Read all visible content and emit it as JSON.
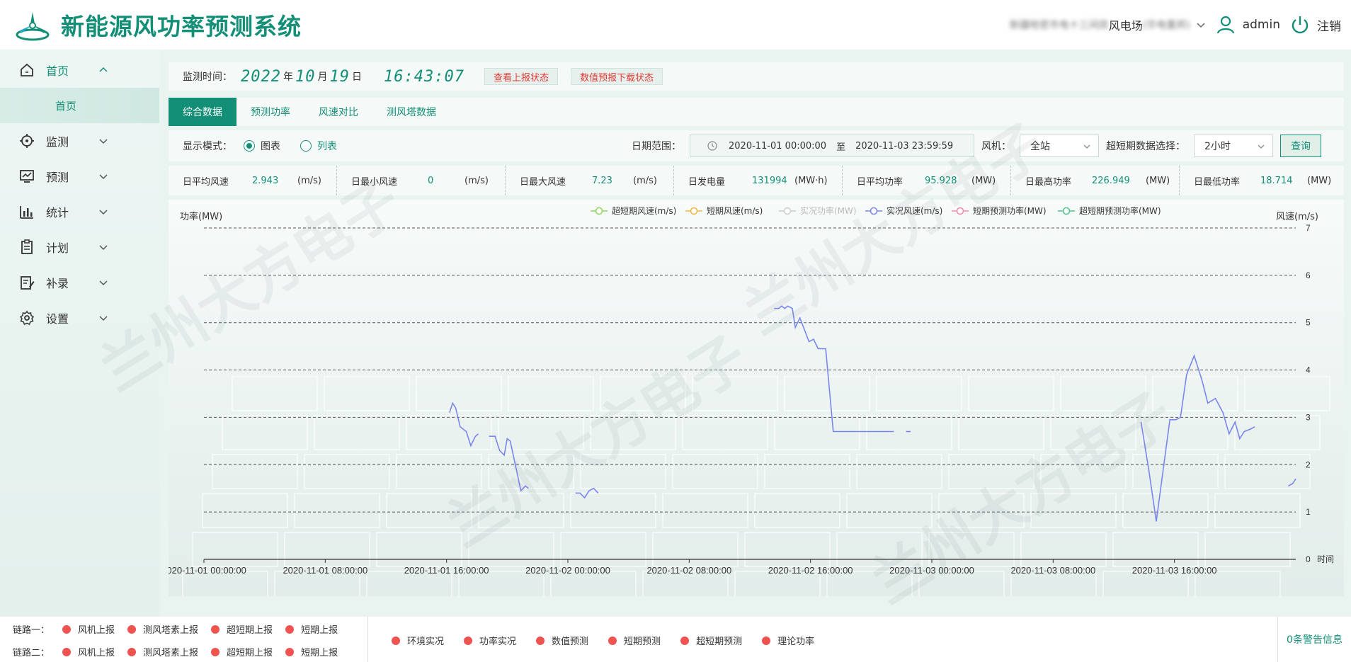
{
  "app": {
    "title": "新能源风功率预测系统"
  },
  "header": {
    "farm_prefix_blur": "新疆哈密市电十三间房",
    "farm_name": "风电场",
    "farm_suffix_blur": "(华电重邦)",
    "user": "admin",
    "logout": "注销"
  },
  "sidebar": {
    "items": [
      {
        "label": "首页",
        "icon": "home-icon"
      },
      {
        "label": "监测",
        "icon": "target-icon"
      },
      {
        "label": "预测",
        "icon": "forecast-icon"
      },
      {
        "label": "统计",
        "icon": "bar-chart-icon"
      },
      {
        "label": "计划",
        "icon": "clipboard-icon"
      },
      {
        "label": "补录",
        "icon": "edit-icon"
      },
      {
        "label": "设置",
        "icon": "gear-icon"
      }
    ],
    "sub_home": "首页"
  },
  "monitor": {
    "label": "监测时间：",
    "year": "2022",
    "year_unit": "年",
    "month": "10",
    "month_unit": "月",
    "day": "19",
    "day_unit": "日",
    "time": "16:43:07",
    "btn_report": "查看上报状态",
    "btn_download": "数值预报下载状态"
  },
  "tabs": [
    "综合数据",
    "预测功率",
    "风速对比",
    "测风塔数据"
  ],
  "filter": {
    "mode_label": "显示模式：",
    "mode_chart": "图表",
    "mode_list": "列表",
    "date_label": "日期范围：",
    "date_start": "2020-11-01 00:00:00",
    "date_sep": "至",
    "date_end": "2020-11-03 23:59:59",
    "fan_label": "风机：",
    "fan_value": "全站",
    "ss_label": "超短期数据选择：",
    "ss_value": "2小时",
    "query": "查询"
  },
  "stats": [
    {
      "label": "日平均风速",
      "value": "2.943",
      "unit": "(m/s)"
    },
    {
      "label": "日最小风速",
      "value": "0",
      "unit": "(m/s)"
    },
    {
      "label": "日最大风速",
      "value": "7.23",
      "unit": "(m/s)"
    },
    {
      "label": "日发电量",
      "value": "131994",
      "unit": "(MW·h)"
    },
    {
      "label": "日平均功率",
      "value": "95.928",
      "unit": "(MW)"
    },
    {
      "label": "日最高功率",
      "value": "226.949",
      "unit": "(MW)"
    },
    {
      "label": "日最低功率",
      "value": "18.714",
      "unit": "(MW)"
    }
  ],
  "chart_data": {
    "type": "line",
    "y_left_label": "功率(MW)",
    "y_right_label": "风速(m/s)",
    "x_axis_name": "时间",
    "y_right_range": [
      0,
      7
    ],
    "y_right_ticks": [
      "0",
      "1",
      "2",
      "3",
      "4",
      "5",
      "6",
      "7"
    ],
    "x_ticks": [
      "2020-11-01 00:00:00",
      "2020-11-01 08:00:00",
      "2020-11-01 16:00:00",
      "2020-11-02 00:00:00",
      "2020-11-02 08:00:00",
      "2020-11-02 16:00:00",
      "2020-11-03 00:00:00",
      "2020-11-03 08:00:00",
      "2020-11-03 16:00:00"
    ],
    "x_range_hours": [
      0,
      72
    ],
    "legend": [
      {
        "name": "超短期风速(m/s)",
        "color": "#8fd45a",
        "active": true
      },
      {
        "name": "短期风速(m/s)",
        "color": "#f2b63c",
        "active": true
      },
      {
        "name": "实况功率(MW)",
        "color": "#cccccc",
        "active": false
      },
      {
        "name": "实况风速(m/s)",
        "color": "#7a86ee",
        "active": true
      },
      {
        "name": "短期预测功率(MW)",
        "color": "#f58aa6",
        "active": true
      },
      {
        "name": "超短期预测功率(MW)",
        "color": "#4cc38a",
        "active": true
      }
    ],
    "series": [
      {
        "name": "实况风速(m/s)",
        "color": "#7a86ee",
        "segments": [
          [
            [
              16.2,
              3.1
            ],
            [
              16.4,
              3.3
            ],
            [
              16.6,
              3.2
            ],
            [
              16.9,
              2.8
            ],
            [
              17.3,
              2.7
            ],
            [
              17.6,
              2.4
            ],
            [
              17.9,
              2.6
            ],
            [
              18.1,
              2.65
            ]
          ],
          [
            [
              18.8,
              2.6
            ],
            [
              19.2,
              2.6
            ],
            [
              19.5,
              2.3
            ],
            [
              19.8,
              2.2
            ],
            [
              20.0,
              2.55
            ],
            [
              20.2,
              2.5
            ],
            [
              20.6,
              1.9
            ],
            [
              20.9,
              1.45
            ],
            [
              21.2,
              1.55
            ],
            [
              21.4,
              1.5
            ]
          ],
          [
            [
              24.5,
              1.4
            ],
            [
              24.8,
              1.4
            ],
            [
              25.1,
              1.3
            ],
            [
              25.4,
              1.45
            ],
            [
              25.7,
              1.5
            ],
            [
              26.0,
              1.4
            ]
          ],
          [
            [
              37.6,
              5.3
            ],
            [
              37.9,
              5.3
            ],
            [
              38.1,
              5.35
            ],
            [
              38.3,
              5.3
            ],
            [
              38.5,
              5.35
            ],
            [
              38.8,
              5.3
            ],
            [
              39.0,
              4.9
            ],
            [
              39.3,
              5.1
            ],
            [
              39.6,
              4.85
            ],
            [
              39.9,
              4.6
            ],
            [
              40.2,
              4.65
            ],
            [
              40.5,
              4.45
            ],
            [
              41.0,
              4.45
            ],
            [
              41.3,
              3.4
            ],
            [
              41.5,
              2.7
            ],
            [
              42.2,
              2.7
            ],
            [
              44.0,
              2.7
            ],
            [
              45.5,
              2.7
            ]
          ],
          [
            [
              46.3,
              2.7
            ],
            [
              46.6,
              2.7
            ]
          ],
          [
            [
              61.8,
              2.9
            ],
            [
              62.3,
              1.9
            ],
            [
              62.8,
              0.8
            ],
            [
              63.3,
              2.0
            ],
            [
              63.7,
              2.95
            ],
            [
              64.1,
              2.95
            ],
            [
              64.4,
              3.0
            ],
            [
              64.8,
              3.9
            ],
            [
              65.3,
              4.3
            ],
            [
              65.8,
              3.8
            ],
            [
              66.2,
              3.3
            ],
            [
              66.7,
              3.4
            ],
            [
              67.2,
              3.1
            ],
            [
              67.6,
              2.65
            ],
            [
              68.0,
              2.9
            ],
            [
              68.3,
              2.55
            ],
            [
              68.6,
              2.7
            ],
            [
              69.0,
              2.75
            ],
            [
              69.3,
              2.8
            ]
          ],
          [
            [
              71.5,
              1.55
            ],
            [
              71.8,
              1.6
            ],
            [
              72.0,
              1.7
            ]
          ]
        ]
      }
    ]
  },
  "footer": {
    "link1_label": "链路一：",
    "link2_label": "链路二：",
    "link_items": [
      "风机上报",
      "测风塔素上报",
      "超短期上报",
      "短期上报"
    ],
    "mid_items": [
      "环境实况",
      "功率实况",
      "数值预测",
      "短期预测",
      "超短期预测",
      "理论功率"
    ],
    "warning": "0条警告信息"
  },
  "watermark": "兰州大方电子"
}
